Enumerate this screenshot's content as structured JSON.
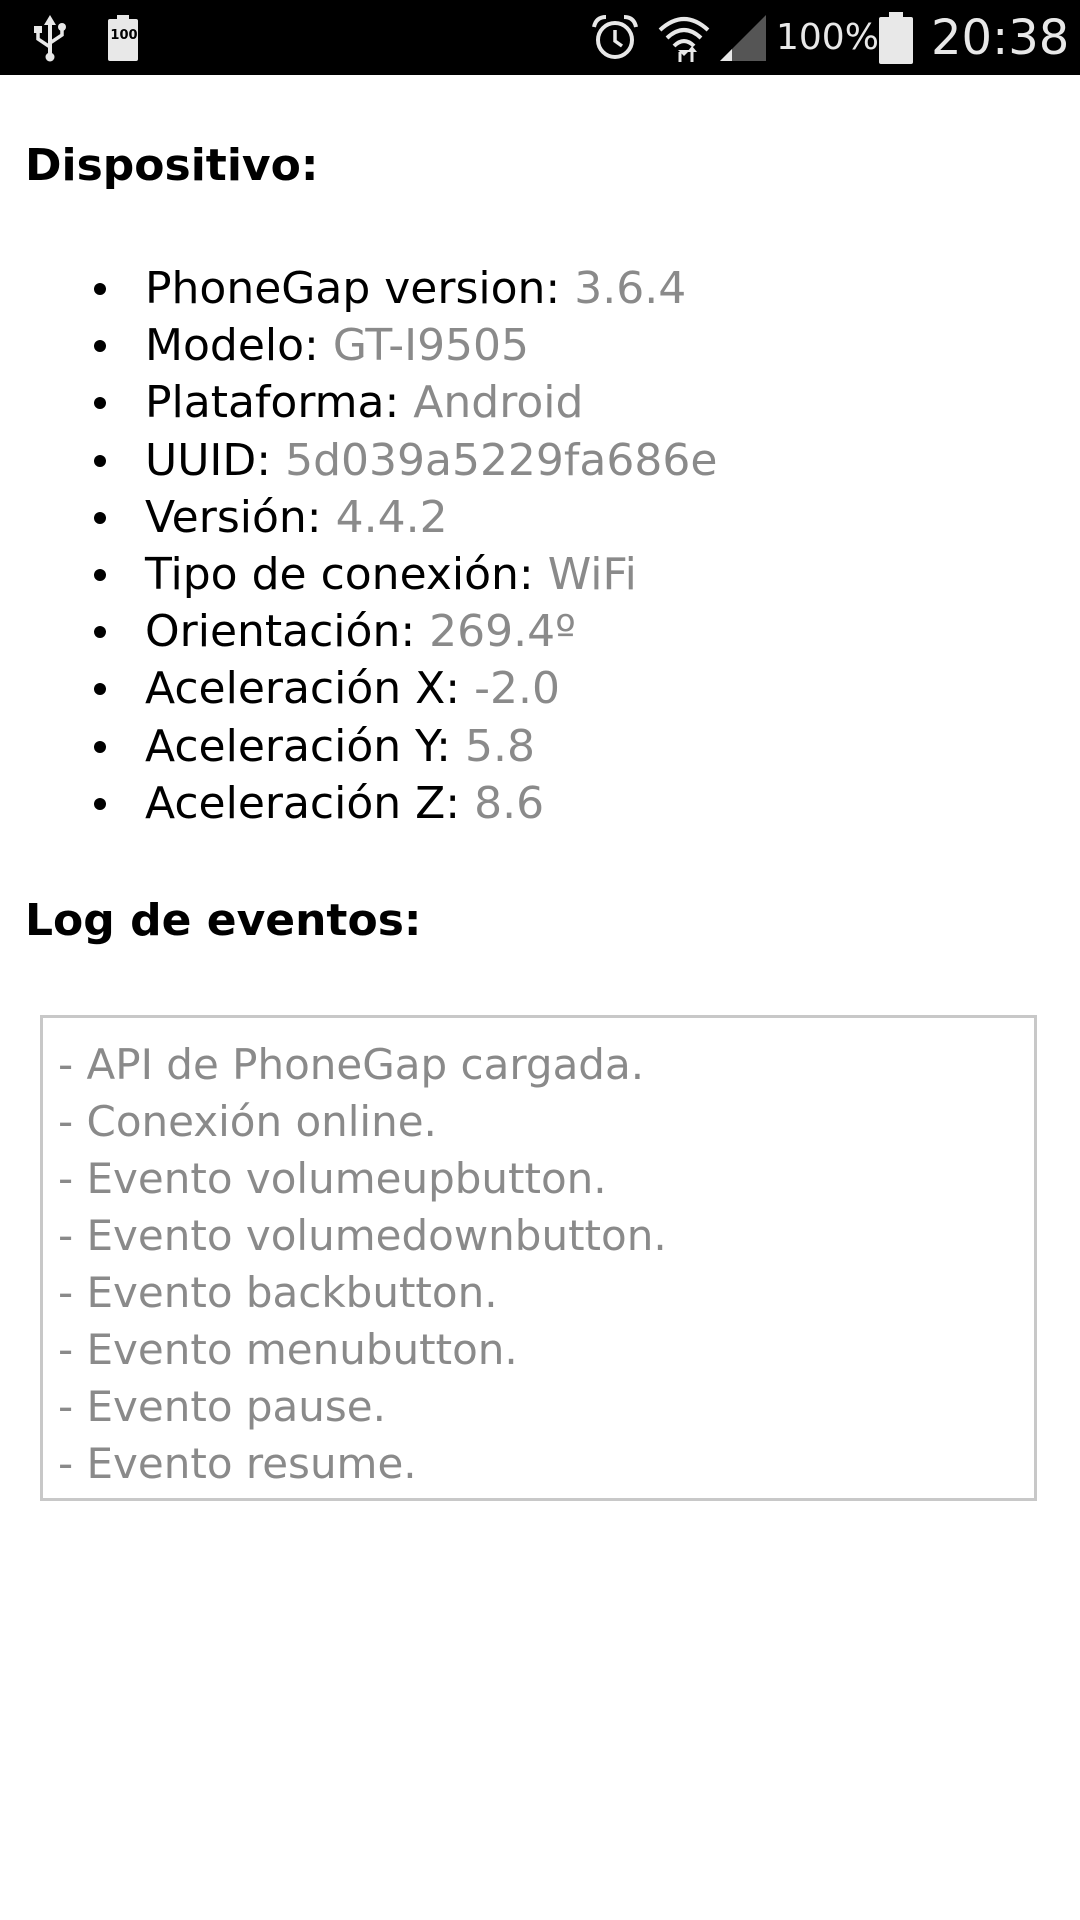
{
  "status_bar": {
    "left_icons": [
      "usb-icon",
      "battery-100-notification-icon"
    ],
    "battery_badge": "100",
    "right_icons": [
      "alarm-icon",
      "wifi-icon",
      "signal-icon",
      "battery-icon"
    ],
    "battery_percent": "100%",
    "time": "20:38"
  },
  "device": {
    "heading": "Dispositivo:",
    "items": [
      {
        "label": "PhoneGap version: ",
        "value": "3.6.4"
      },
      {
        "label": "Modelo: ",
        "value": "GT-I9505"
      },
      {
        "label": "Plataforma: ",
        "value": "Android"
      },
      {
        "label": "UUID: ",
        "value": "5d039a5229fa686e"
      },
      {
        "label": "Versión: ",
        "value": "4.4.2"
      },
      {
        "label": "Tipo de conexión: ",
        "value": "WiFi"
      },
      {
        "label": "Orientación: ",
        "value": "269.4º"
      },
      {
        "label": "Aceleración X: ",
        "value": "-2.0"
      },
      {
        "label": "Aceleración Y: ",
        "value": "5.8"
      },
      {
        "label": "Aceleración Z: ",
        "value": "8.6"
      }
    ]
  },
  "log": {
    "heading": "Log de eventos:",
    "entries": [
      "- API de PhoneGap cargada.",
      "- Conexión online.",
      "- Evento volumeupbutton.",
      "- Evento volumedownbutton.",
      "- Evento backbutton.",
      "- Evento menubutton.",
      "- Evento pause.",
      "- Evento resume."
    ]
  },
  "colors": {
    "status_bar_bg": "#000000",
    "value_text": "#8a8a8a",
    "log_border": "#c8c8c8"
  }
}
